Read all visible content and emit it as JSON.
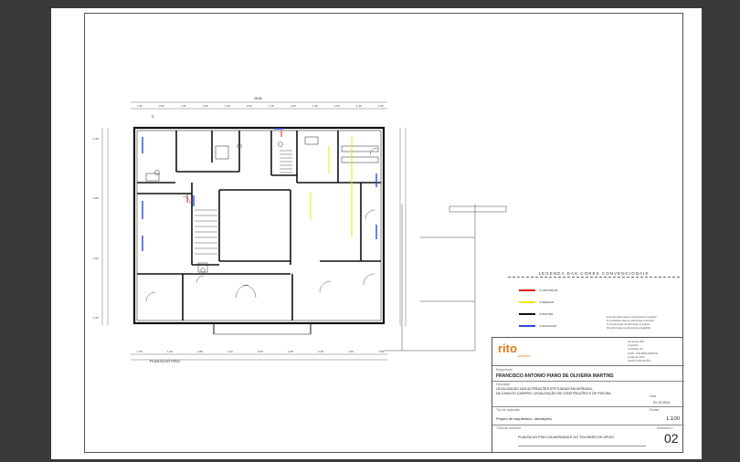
{
  "drawing": {
    "overall_width": "28.65",
    "side_dims": [
      "1.55",
      "3.60",
      "2.50",
      "1.55"
    ],
    "top_dims": [
      "1.30",
      "0.90",
      "1.95",
      "0.90",
      "2.20",
      "0.90",
      "1.45",
      "2.45",
      "1.45",
      "1.65",
      "1.40",
      "1.80"
    ],
    "bottom_dims": [
      "1.55",
      "1.40",
      "2.80",
      "3.40",
      "3.60",
      "1.45",
      "3.45",
      "1.60",
      "1.65"
    ],
    "axis_marker": "D",
    "caption": "PLANTA DO PISO"
  },
  "legend": {
    "title": "LEGENDA DAS CORES CONVENCIONAIS",
    "items": [
      {
        "color": "#e02020",
        "label": "A CONSTRUIR"
      },
      {
        "color": "#f2e600",
        "label": "A DEMOLIR"
      },
      {
        "color": "#111111",
        "label": "A MANTER"
      },
      {
        "color": "#2a4bd7",
        "label": "A LEGALIZAR"
      }
    ],
    "notes": [
      "a) A vermelho para os elementos a construir",
      "b) A amarelo para os elementos a demolir",
      "c) A preto para os elementos a manter",
      "d) A azul para os elementos a legalizar"
    ]
  },
  "title_block": {
    "logo_text": "rito",
    "logo_sub": "projectos",
    "info_lines": [
      "Henrique Rito",
      "Arquiteto",
      "Inscrição OA",
      "2135 - 049 BENAVENTE",
      "Local da Obra",
      "SANTO ESTEVÃO"
    ],
    "requerente_label": "Requerente",
    "owner": "FRANCISCO ANTÓNIO PIANO DE OLIVEIRA MARTINS",
    "descricao_label": "Descrição",
    "description": [
      "LEGALIZAÇÃO DAS ALTERAÇÕES EFETUADAS EM MORADIA,",
      "NA CASA DO CASEIRO, LEGALIZAÇÃO DE CONSTRUÇÕES E DE PISCINA."
    ],
    "data_label": "Data",
    "date": "01.10.2024",
    "tipo_label": "Tipo de aplicação",
    "project_type": "Projeto de Arquitetura - alterações",
    "escala_label": "Escala",
    "scale": "1:100",
    "desenho_label": "Título do desenho",
    "drawing_title": "PLANTA DO PISO DA MORADIA E DO TELHEIRO DE APOIO",
    "numero_label": "Desenho n.º",
    "sheet_no": "02"
  }
}
